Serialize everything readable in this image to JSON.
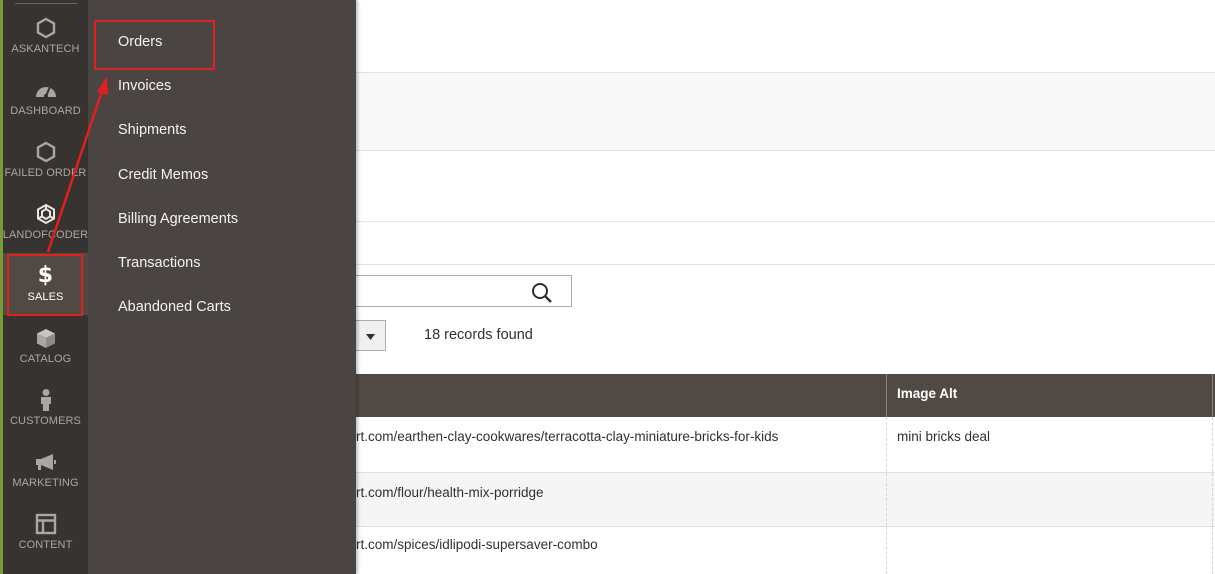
{
  "nav": {
    "items": [
      {
        "label": "ASKANTECH",
        "icon": "hexagon-icon"
      },
      {
        "label": "DASHBOARD",
        "icon": "speedometer-icon"
      },
      {
        "label": "FAILED ORDER",
        "icon": "hexagon-icon"
      },
      {
        "label": "LANDOFCODER",
        "icon": "landofcoder-logo-icon"
      },
      {
        "label": "SALES",
        "icon": "dollar-icon"
      },
      {
        "label": "CATALOG",
        "icon": "cube-icon"
      },
      {
        "label": "CUSTOMERS",
        "icon": "person-icon"
      },
      {
        "label": "MARKETING",
        "icon": "megaphone-icon"
      },
      {
        "label": "CONTENT",
        "icon": "layout-icon"
      }
    ],
    "active": "SALES"
  },
  "sales_menu": {
    "items": [
      "Orders",
      "Invoices",
      "Shipments",
      "Credit Memos",
      "Billing Agreements",
      "Transactions",
      "Abandoned Carts"
    ]
  },
  "grid": {
    "records_found": "18 records found",
    "columns": {
      "image_alt": "Image Alt"
    },
    "rows": [
      {
        "url": "rt.com/earthen-clay-cookwares/terracotta-clay-miniature-bricks-for-kids",
        "image_alt": "mini bricks deal"
      },
      {
        "url": "rt.com/flour/health-mix-porridge",
        "image_alt": ""
      },
      {
        "url": "rt.com/spices/idlipodi-supersaver-combo",
        "image_alt": ""
      }
    ]
  },
  "colors": {
    "nav_bg": "#373330",
    "flyout_bg": "#4a4542",
    "header_bg": "#514943",
    "highlight": "#e0201f"
  }
}
